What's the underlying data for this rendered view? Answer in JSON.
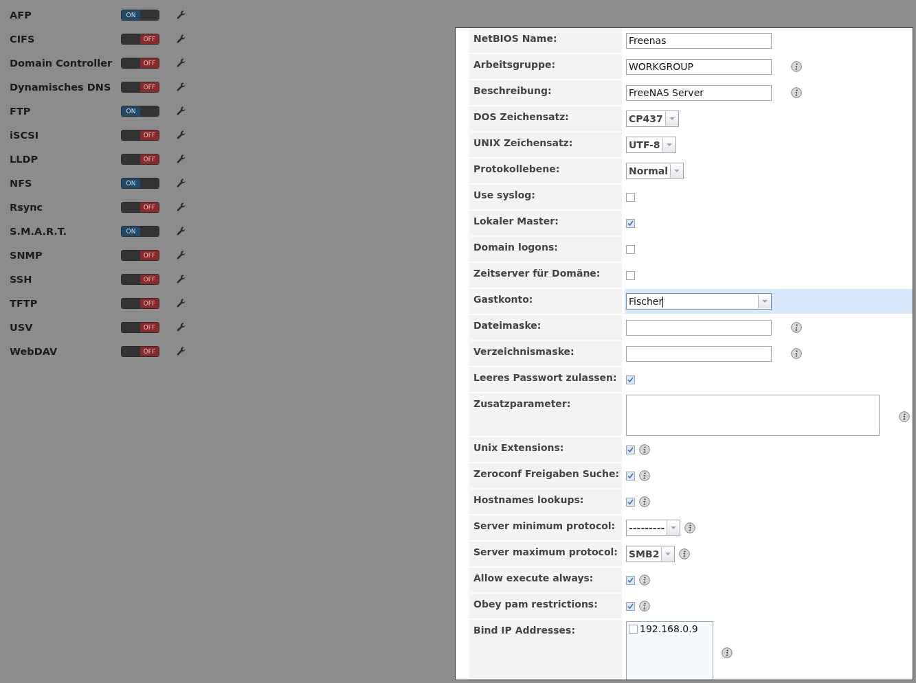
{
  "services": [
    {
      "name": "AFP",
      "on": true,
      "on_label": "ON"
    },
    {
      "name": "CIFS",
      "on": false,
      "off_label": "OFF"
    },
    {
      "name": "Domain Controller",
      "on": false,
      "off_label": "OFF"
    },
    {
      "name": "Dynamisches DNS",
      "on": false,
      "off_label": "OFF"
    },
    {
      "name": "FTP",
      "on": true,
      "on_label": "ON"
    },
    {
      "name": "iSCSI",
      "on": false,
      "off_label": "OFF"
    },
    {
      "name": "LLDP",
      "on": false,
      "off_label": "OFF"
    },
    {
      "name": "NFS",
      "on": true,
      "on_label": "ON"
    },
    {
      "name": "Rsync",
      "on": false,
      "off_label": "OFF"
    },
    {
      "name": "S.M.A.R.T.",
      "on": true,
      "on_label": "ON"
    },
    {
      "name": "SNMP",
      "on": false,
      "off_label": "OFF"
    },
    {
      "name": "SSH",
      "on": false,
      "off_label": "OFF"
    },
    {
      "name": "TFTP",
      "on": false,
      "off_label": "OFF"
    },
    {
      "name": "USV",
      "on": false,
      "off_label": "OFF"
    },
    {
      "name": "WebDAV",
      "on": false,
      "off_label": "OFF"
    }
  ],
  "dialog": {
    "fields": [
      {
        "kind": "text",
        "label": "NetBIOS Name:",
        "value": "Freenas",
        "info": false,
        "focused": false
      },
      {
        "kind": "text",
        "label": "Arbeitsgruppe:",
        "value": "WORKGROUP",
        "info": true,
        "focused": false
      },
      {
        "kind": "text",
        "label": "Beschreibung:",
        "value": "FreeNAS Server",
        "info": true,
        "focused": false
      },
      {
        "kind": "select",
        "label": "DOS Zeichensatz:",
        "value": "CP437",
        "info": false,
        "focused": false
      },
      {
        "kind": "select",
        "label": "UNIX Zeichensatz:",
        "value": "UTF-8",
        "info": false,
        "focused": false
      },
      {
        "kind": "select",
        "label": "Protokollebene:",
        "value": "Normal",
        "info": false,
        "focused": false
      },
      {
        "kind": "checkbox",
        "label": "Use syslog:",
        "checked": false,
        "info": false,
        "focused": false
      },
      {
        "kind": "checkbox",
        "label": "Lokaler Master:",
        "checked": true,
        "info": false,
        "focused": false
      },
      {
        "kind": "checkbox",
        "label": "Domain logons:",
        "checked": false,
        "info": false,
        "focused": false
      },
      {
        "kind": "checkbox",
        "label": "Zeitserver für Domäne:",
        "checked": false,
        "info": false,
        "focused": false
      },
      {
        "kind": "combo",
        "label": "Gastkonto:",
        "value": "Fischer",
        "info": false,
        "focused": true
      },
      {
        "kind": "text",
        "label": "Dateimaske:",
        "info": true,
        "focused": false
      },
      {
        "kind": "text",
        "label": "Verzeichnismaske:",
        "info": true,
        "focused": false
      },
      {
        "kind": "checkbox",
        "label": "Leeres Passwort zulassen:",
        "checked": true,
        "info": false,
        "focused": false
      },
      {
        "kind": "textarea",
        "label": "Zusatzparameter:",
        "info": true,
        "focused": false
      },
      {
        "kind": "checkbox",
        "label": "Unix Extensions:",
        "checked": true,
        "info": true,
        "focused": false
      },
      {
        "kind": "checkbox",
        "label": "Zeroconf Freigaben Suche:",
        "checked": true,
        "info": true,
        "focused": false
      },
      {
        "kind": "checkbox",
        "label": "Hostnames lookups:",
        "checked": true,
        "info": true,
        "focused": false
      },
      {
        "kind": "select",
        "label": "Server minimum protocol:",
        "value": "---------",
        "info": true,
        "focused": false
      },
      {
        "kind": "select",
        "label": "Server maximum protocol:",
        "value": "SMB2",
        "info": true,
        "focused": false
      },
      {
        "kind": "checkbox",
        "label": "Allow execute always:",
        "checked": true,
        "info": true,
        "focused": false
      },
      {
        "kind": "checkbox",
        "label": "Obey pam restrictions:",
        "checked": true,
        "info": true,
        "focused": false
      },
      {
        "kind": "iplist",
        "label": "Bind IP Addresses:",
        "info": true,
        "focused": false,
        "options": [
          {
            "label": "192.168.0.9",
            "checked": false
          }
        ]
      }
    ]
  }
}
